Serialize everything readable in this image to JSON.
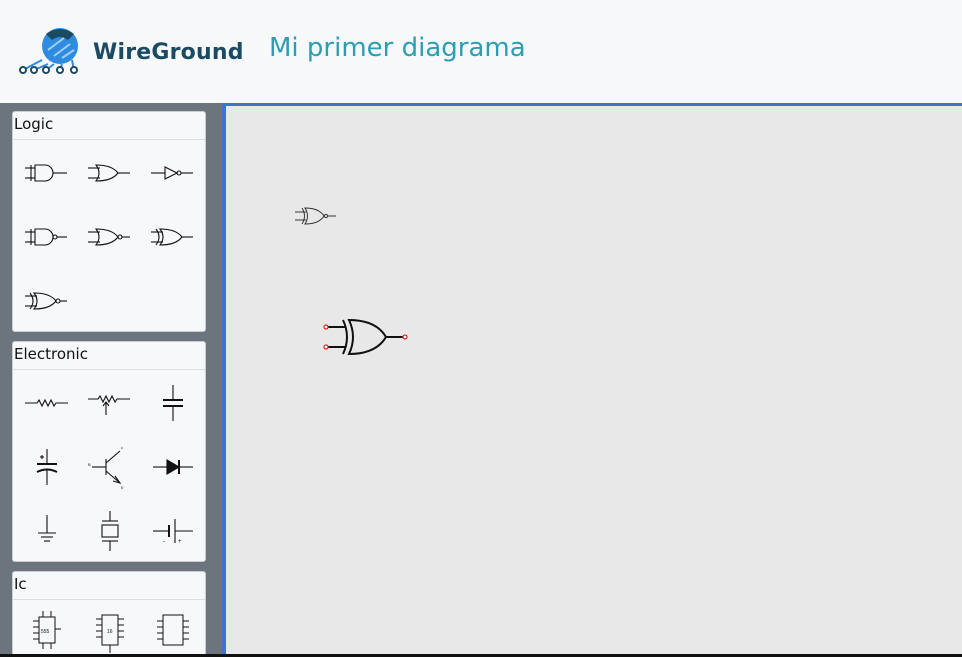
{
  "header": {
    "brand": "WireGround",
    "diagram_title": "Mi primer diagrama"
  },
  "sidebar": {
    "panels": [
      {
        "title": "Logic",
        "items": [
          "and-gate-icon",
          "or-gate-icon",
          "not-gate-icon",
          "nand-gate-icon",
          "nor-gate-icon",
          "xor-gate-icon",
          "xnor-gate-icon"
        ]
      },
      {
        "title": "Electronic",
        "items": [
          "resistor-icon",
          "potentiometer-icon",
          "capacitor-icon",
          "polarized-capacitor-icon",
          "transistor-icon",
          "diode-icon",
          "ground-icon",
          "crystal-icon",
          "battery-icon"
        ]
      },
      {
        "title": "Ic",
        "items": [
          "ic-555-icon",
          "ic-16-pin-icon",
          "ic-8-pin-icon"
        ]
      }
    ],
    "ic_labels": {
      "ic555": "555",
      "ic16": "16"
    },
    "transistor_labels": {
      "c": "c",
      "b": "B",
      "e": "E"
    },
    "battery_labels": {
      "neg": "-",
      "pos": "+"
    }
  },
  "canvas": {
    "components": [
      "xnor-gate-small",
      "xor-gate-selected"
    ]
  },
  "colors": {
    "accent_blue": "#3a76cf",
    "brand_dark": "#1b4a63",
    "title_teal": "#2d9db3",
    "sidebar_bg": "#6c757d",
    "canvas_bg": "#e8e8e8",
    "connector_red": "#e02020"
  }
}
